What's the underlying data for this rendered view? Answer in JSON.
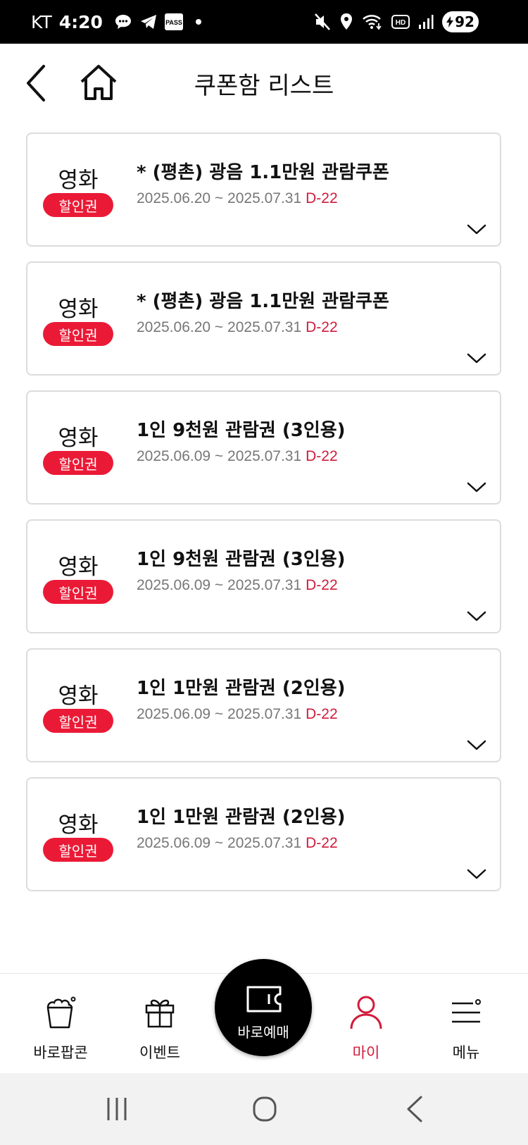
{
  "status_bar": {
    "carrier": "KT",
    "time": "4:20",
    "left_icons": [
      "chat-bubble-icon",
      "telegram-icon",
      "pass-app-icon",
      "dot"
    ],
    "pass_label": "PASS",
    "right_icons": [
      "mute-icon",
      "location-icon",
      "wifi-icon",
      "hd-icon",
      "signal-icon"
    ],
    "battery": "92"
  },
  "header": {
    "title": "쿠폰함 리스트",
    "back_icon": "chevron-left-icon",
    "home_icon": "home-icon"
  },
  "coupons": [
    {
      "category": "영화",
      "badge": "할인권",
      "title": "* (평촌) 광음 1.1만원 관람쿠폰",
      "period": "2025.06.20 ~ 2025.07.31",
      "dday": "D-22"
    },
    {
      "category": "영화",
      "badge": "할인권",
      "title": "* (평촌) 광음 1.1만원 관람쿠폰",
      "period": "2025.06.20 ~ 2025.07.31",
      "dday": "D-22"
    },
    {
      "category": "영화",
      "badge": "할인권",
      "title": "1인 9천원 관람권 (3인용)",
      "period": "2025.06.09 ~ 2025.07.31",
      "dday": "D-22"
    },
    {
      "category": "영화",
      "badge": "할인권",
      "title": "1인 9천원 관람권 (3인용)",
      "period": "2025.06.09 ~ 2025.07.31",
      "dday": "D-22"
    },
    {
      "category": "영화",
      "badge": "할인권",
      "title": "1인 1만원 관람권 (2인용)",
      "period": "2025.06.09 ~ 2025.07.31",
      "dday": "D-22"
    },
    {
      "category": "영화",
      "badge": "할인권",
      "title": "1인 1만원 관람권 (2인용)",
      "period": "2025.06.09 ~ 2025.07.31",
      "dday": "D-22"
    }
  ],
  "bottom_nav": {
    "items": [
      {
        "label": "바로팝콘",
        "icon": "popcorn-icon",
        "active": false
      },
      {
        "label": "이벤트",
        "icon": "gift-icon",
        "active": false
      },
      {
        "label": "바로예매",
        "icon": "ticket-icon",
        "active": false
      },
      {
        "label": "마이",
        "icon": "person-icon",
        "active": true
      },
      {
        "label": "메뉴",
        "icon": "menu-icon",
        "active": false
      }
    ]
  },
  "colors": {
    "accent": "#ea1a36",
    "dday": "#d21b3c",
    "card_border": "#dcdcdc",
    "status_bar": "#000000"
  }
}
